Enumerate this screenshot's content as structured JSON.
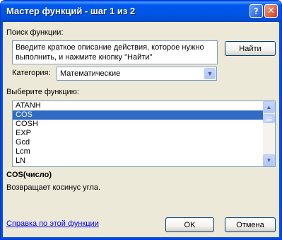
{
  "window": {
    "title": "Мастер функций - шаг 1 из 2"
  },
  "search": {
    "label": "Поиск функции:",
    "text": "Введите краткое описание действия, которое нужно выполнить, и нажмите кнопку \"Найти\"",
    "find_button": "Найти"
  },
  "category": {
    "label": "Категория:",
    "value": "Математические"
  },
  "functions": {
    "label": "Выберите функцию:",
    "items": [
      "ATANH",
      "COS",
      "COSH",
      "EXP",
      "Gcd",
      "Lcm",
      "LN"
    ],
    "selected": "COS"
  },
  "details": {
    "signature": "COS(число)",
    "description": "Возвращает косинус угла."
  },
  "footer": {
    "help_link": "Справка по этой функции",
    "ok": "OK",
    "cancel": "Отмена"
  },
  "colors": {
    "titlebar": "#0055e5",
    "selection": "#316ac5",
    "dialog_bg": "#ece9d8",
    "link": "#0000ff"
  },
  "icons": {
    "help": "question-mark",
    "close": "x-mark",
    "dropdown": "chevron-down",
    "scroll_up": "triangle-up",
    "scroll_down": "triangle-down"
  }
}
